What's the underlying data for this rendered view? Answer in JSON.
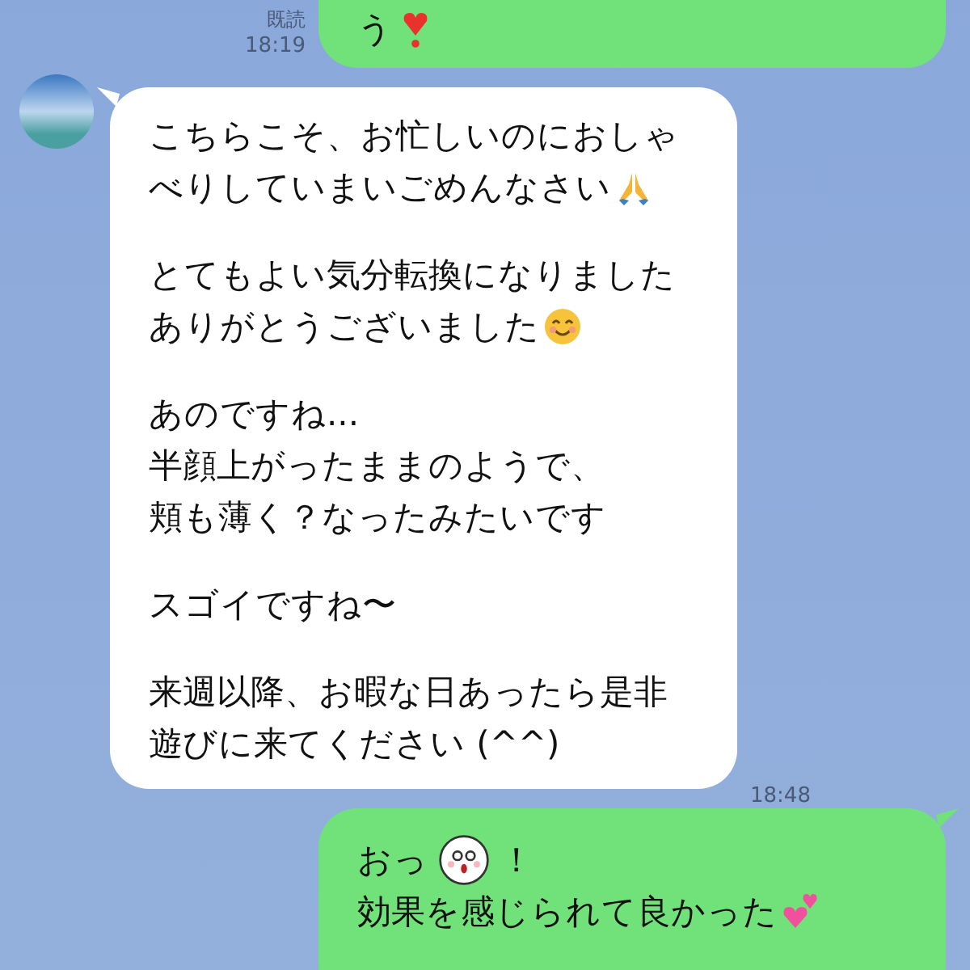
{
  "messages": [
    {
      "kind": "sent",
      "read_receipt": "既読",
      "time": "18:19",
      "paragraphs": [
        [
          {
            "text": "う",
            "kind": "heart_exclamation"
          }
        ]
      ]
    },
    {
      "kind": "received",
      "time": "18:48",
      "paragraphs": [
        [
          {
            "text": "こちらこそ、お忙しいのにおしゃ",
            "kind": "plain"
          },
          {
            "text": "べりしていまいごめんなさい",
            "kind": "pray"
          }
        ],
        [
          {
            "text": "とてもよい気分転換になりました",
            "kind": "plain"
          },
          {
            "text": "ありがとうございました",
            "kind": "smile"
          }
        ],
        [
          {
            "text": "あのですね...",
            "kind": "plain"
          },
          {
            "text": "半顔上がったままのようで、",
            "kind": "plain"
          },
          {
            "text": "頬も薄く？なったみたいです",
            "kind": "plain"
          }
        ],
        [
          {
            "text": "スゴイですね〜",
            "kind": "plain"
          }
        ],
        [
          {
            "text": "来週以降、お暇な日あったら是非",
            "kind": "plain"
          },
          {
            "text": "遊びに来てください (^^)",
            "kind": "plain"
          }
        ]
      ]
    },
    {
      "kind": "sent",
      "paragraphs": [
        [
          {
            "text": "おっ",
            "kind": "surprised_face",
            "after": "！"
          },
          {
            "text": "効果を感じられて良かった",
            "kind": "hearts"
          }
        ]
      ]
    }
  ]
}
